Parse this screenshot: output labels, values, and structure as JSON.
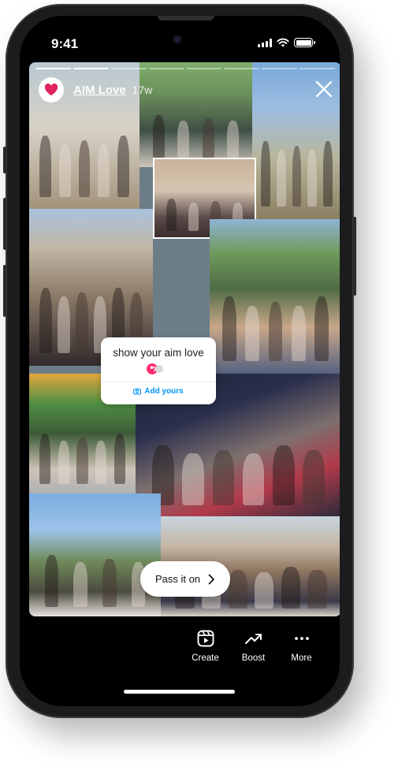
{
  "status_bar": {
    "time": "9:41",
    "battery_level": 1.0
  },
  "story": {
    "username": "AIM Love",
    "time_ago": "17w",
    "progress": {
      "segments": 8,
      "completed": 2
    },
    "collage_photos": [
      "group-photo-icon",
      "group-photo-icon",
      "group-photo-icon",
      "group-photo-icon",
      "group-photo-icon",
      "group-photo-icon",
      "group-photo-icon",
      "group-photo-icon",
      "group-photo-icon",
      "group-photo-icon"
    ],
    "add_yours_sticker": {
      "prompt": "show your aim love",
      "button_label": "Add yours"
    },
    "pass_it_on_label": "Pass it on"
  },
  "actions": [
    {
      "label": "Create",
      "icon": "reels-icon"
    },
    {
      "label": "Boost",
      "icon": "trending-up-icon"
    },
    {
      "label": "More",
      "icon": "more-icon"
    }
  ],
  "colors": {
    "accent_blue": "#0095f6",
    "heart_red": "#e0245e",
    "sticker_pink": "#ff2f6e"
  }
}
